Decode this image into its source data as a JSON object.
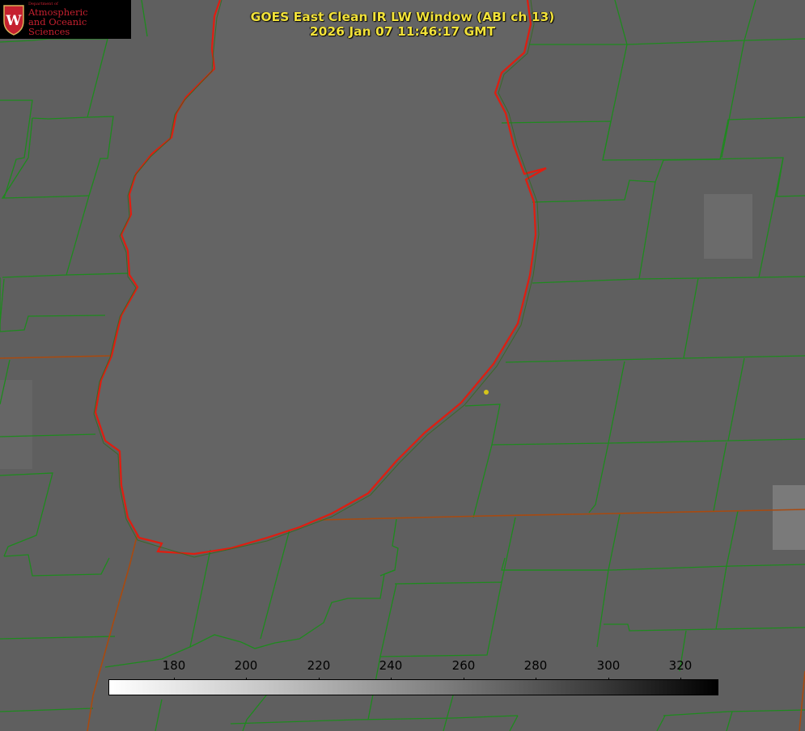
{
  "title": {
    "line1": "GOES East Clean IR LW Window (ABI ch 13)",
    "line2": "2026 Jan 07 11:46:17 GMT"
  },
  "logo": {
    "department": "Department of",
    "line1": "Atmospheric",
    "line2": "and Oceanic Sciences",
    "crest_letter": "W"
  },
  "colorbar": {
    "tick_labels": [
      "180",
      "200",
      "220",
      "240",
      "260",
      "280",
      "300",
      "320"
    ],
    "colormap": "white-to-black (low values white, high values black)"
  },
  "colors": {
    "background": "#5f5f5f",
    "lake": "#646464",
    "county_lines": "#1e8a1e",
    "coastline": "#e01d10",
    "state_border": "#a84a10",
    "title_text": "#f2e23a",
    "marker": "#d6c51a"
  }
}
